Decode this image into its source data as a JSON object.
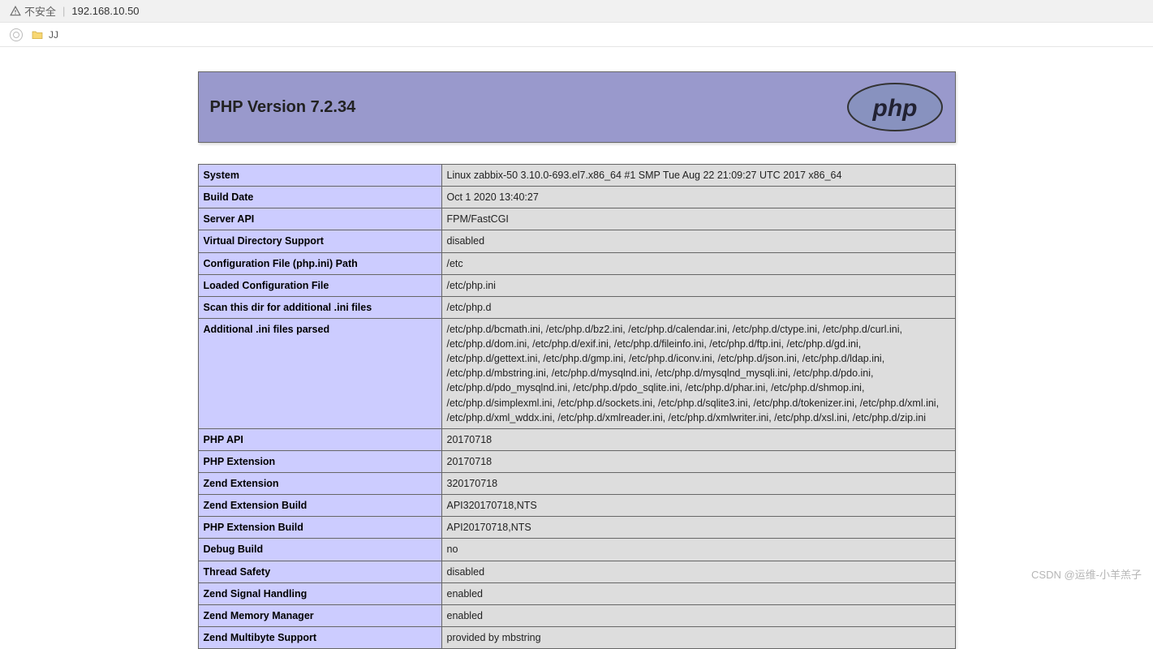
{
  "browser": {
    "security_label": "不安全",
    "url": "192.168.10.50",
    "bookmark": "JJ"
  },
  "php": {
    "title": "PHP Version 7.2.34",
    "logo_text": "php"
  },
  "rows": [
    {
      "label": "System",
      "value": "Linux zabbix-50 3.10.0-693.el7.x86_64 #1 SMP Tue Aug 22 21:09:27 UTC 2017 x86_64"
    },
    {
      "label": "Build Date",
      "value": "Oct 1 2020 13:40:27"
    },
    {
      "label": "Server API",
      "value": "FPM/FastCGI"
    },
    {
      "label": "Virtual Directory Support",
      "value": "disabled"
    },
    {
      "label": "Configuration File (php.ini) Path",
      "value": "/etc"
    },
    {
      "label": "Loaded Configuration File",
      "value": "/etc/php.ini"
    },
    {
      "label": "Scan this dir for additional .ini files",
      "value": "/etc/php.d"
    },
    {
      "label": "Additional .ini files parsed",
      "value": "/etc/php.d/bcmath.ini, /etc/php.d/bz2.ini, /etc/php.d/calendar.ini, /etc/php.d/ctype.ini, /etc/php.d/curl.ini, /etc/php.d/dom.ini, /etc/php.d/exif.ini, /etc/php.d/fileinfo.ini, /etc/php.d/ftp.ini, /etc/php.d/gd.ini, /etc/php.d/gettext.ini, /etc/php.d/gmp.ini, /etc/php.d/iconv.ini, /etc/php.d/json.ini, /etc/php.d/ldap.ini, /etc/php.d/mbstring.ini, /etc/php.d/mysqlnd.ini, /etc/php.d/mysqlnd_mysqli.ini, /etc/php.d/pdo.ini, /etc/php.d/pdo_mysqlnd.ini, /etc/php.d/pdo_sqlite.ini, /etc/php.d/phar.ini, /etc/php.d/shmop.ini, /etc/php.d/simplexml.ini, /etc/php.d/sockets.ini, /etc/php.d/sqlite3.ini, /etc/php.d/tokenizer.ini, /etc/php.d/xml.ini, /etc/php.d/xml_wddx.ini, /etc/php.d/xmlreader.ini, /etc/php.d/xmlwriter.ini, /etc/php.d/xsl.ini, /etc/php.d/zip.ini"
    },
    {
      "label": "PHP API",
      "value": "20170718"
    },
    {
      "label": "PHP Extension",
      "value": "20170718"
    },
    {
      "label": "Zend Extension",
      "value": "320170718"
    },
    {
      "label": "Zend Extension Build",
      "value": "API320170718,NTS"
    },
    {
      "label": "PHP Extension Build",
      "value": "API20170718,NTS"
    },
    {
      "label": "Debug Build",
      "value": "no"
    },
    {
      "label": "Thread Safety",
      "value": "disabled"
    },
    {
      "label": "Zend Signal Handling",
      "value": "enabled"
    },
    {
      "label": "Zend Memory Manager",
      "value": "enabled"
    },
    {
      "label": "Zend Multibyte Support",
      "value": "provided by mbstring"
    }
  ],
  "watermark": "CSDN @运维-小羊羔子"
}
